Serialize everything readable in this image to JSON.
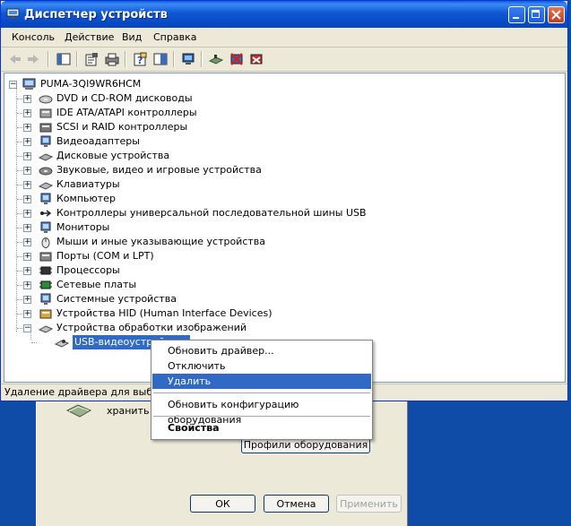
{
  "window": {
    "title": "Диспетчер устройств"
  },
  "menu": [
    "Консоль",
    "Действие",
    "Вид",
    "Справка"
  ],
  "toolbar_icons": [
    "back-icon",
    "forward-icon",
    "show-hide-tree-icon",
    "properties-icon",
    "print-icon",
    "help-icon",
    "view-icon",
    "computer-icon",
    "scan-hardware-icon",
    "disable-icon",
    "uninstall-icon"
  ],
  "tree": {
    "root": "PUMA-3QI9WR6HCM",
    "items": [
      "DVD и CD-ROM дисководы",
      "IDE ATA/ATAPI контроллеры",
      "SCSI и RAID контроллеры",
      "Видеоадаптеры",
      "Дисковые устройства",
      "Звуковые, видео и игровые устройства",
      "Клавиатуры",
      "Компьютер",
      "Контроллеры универсальной последовательной шины USB",
      "Мониторы",
      "Мыши и иные указывающие устройства",
      "Порты (COM и LPT)",
      "Процессоры",
      "Сетевые платы",
      "Системные устройства",
      "Устройства HID (Human Interface Devices)",
      "Устройства обработки изображений"
    ],
    "selected_child": "USB-видеоустройство"
  },
  "status": "Удаление драйвера для выбран",
  "context_menu": {
    "update_driver": "Обновить драйвер...",
    "disable": "Отключить",
    "uninstall": "Удалить",
    "scan": "Обновить конфигурацию оборудования",
    "properties": "Свойства"
  },
  "background_dialog": {
    "text": "хранить р",
    "profiles_button": "Профили оборудования",
    "ok": "ОК",
    "cancel": "Отмена",
    "apply": "Применить"
  }
}
